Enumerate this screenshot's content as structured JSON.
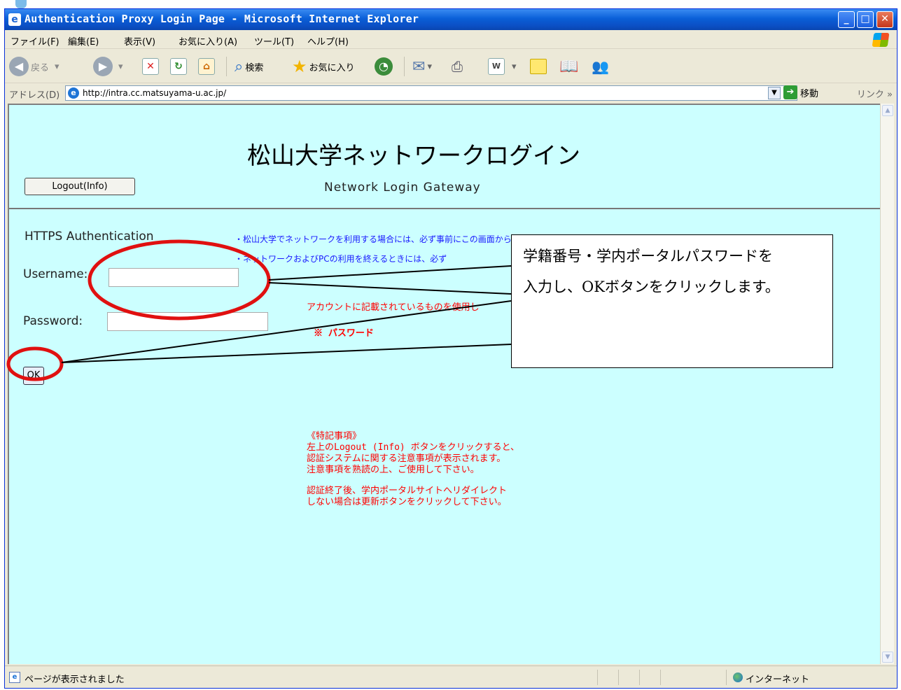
{
  "window": {
    "title": "Authentication Proxy Login Page - Microsoft Internet Explorer"
  },
  "menu": [
    "ファイル(F)",
    "編集(E)",
    "表示(V)",
    "お気に入り(A)",
    "ツール(T)",
    "ヘルプ(H)"
  ],
  "toolbar": {
    "back": "戻る",
    "search": "検索",
    "favorites": "お気に入り"
  },
  "address": {
    "label": "アドレス(D)",
    "url": "http://intra.cc.matsuyama-u.ac.jp/",
    "go": "移動",
    "links": "リンク"
  },
  "page": {
    "logout_button": "Logout(Info)",
    "title": "松山大学ネットワークログイン",
    "subtitle": "Network Login Gateway",
    "auth_heading": "HTTPS Authentication",
    "notice1": "・松山大学でネットワークを利用する場合には、必ず事前にこの画面からログインする必要があります。",
    "notice2": "・ネットワークおよびPCの利用を終えるときには、必ず",
    "username_label": "Username:",
    "username_value": "",
    "password_label": "Password:",
    "password_value": "",
    "ok_button": "OK",
    "red_note_account": "アカウントに記載されているものを使用し",
    "red_note_password": "※ パスワード",
    "special_title": "《特記事項》",
    "special_1": "左上のLogout (Info) ボタンをクリックすると、",
    "special_2": "認証システムに関する注意事項が表示されます。",
    "special_3": "注意事項を熟読の上、ご使用して下さい。",
    "special_4": "認証終了後、学内ポータルサイトへリダイレクト",
    "special_5": "しない場合は更新ボタンをクリックして下さい。"
  },
  "callout": {
    "line1": "学籍番号・学内ポータルパスワードを",
    "line2": "入力し、OKボタンをクリックします。"
  },
  "status": {
    "text": "ページが表示されました",
    "zone": "インターネット"
  },
  "colors": {
    "content_bg": "#ccffff",
    "accent_red": "#ff0000",
    "notice_blue": "#1a1aff",
    "xp_title": "#0a5fd8"
  }
}
